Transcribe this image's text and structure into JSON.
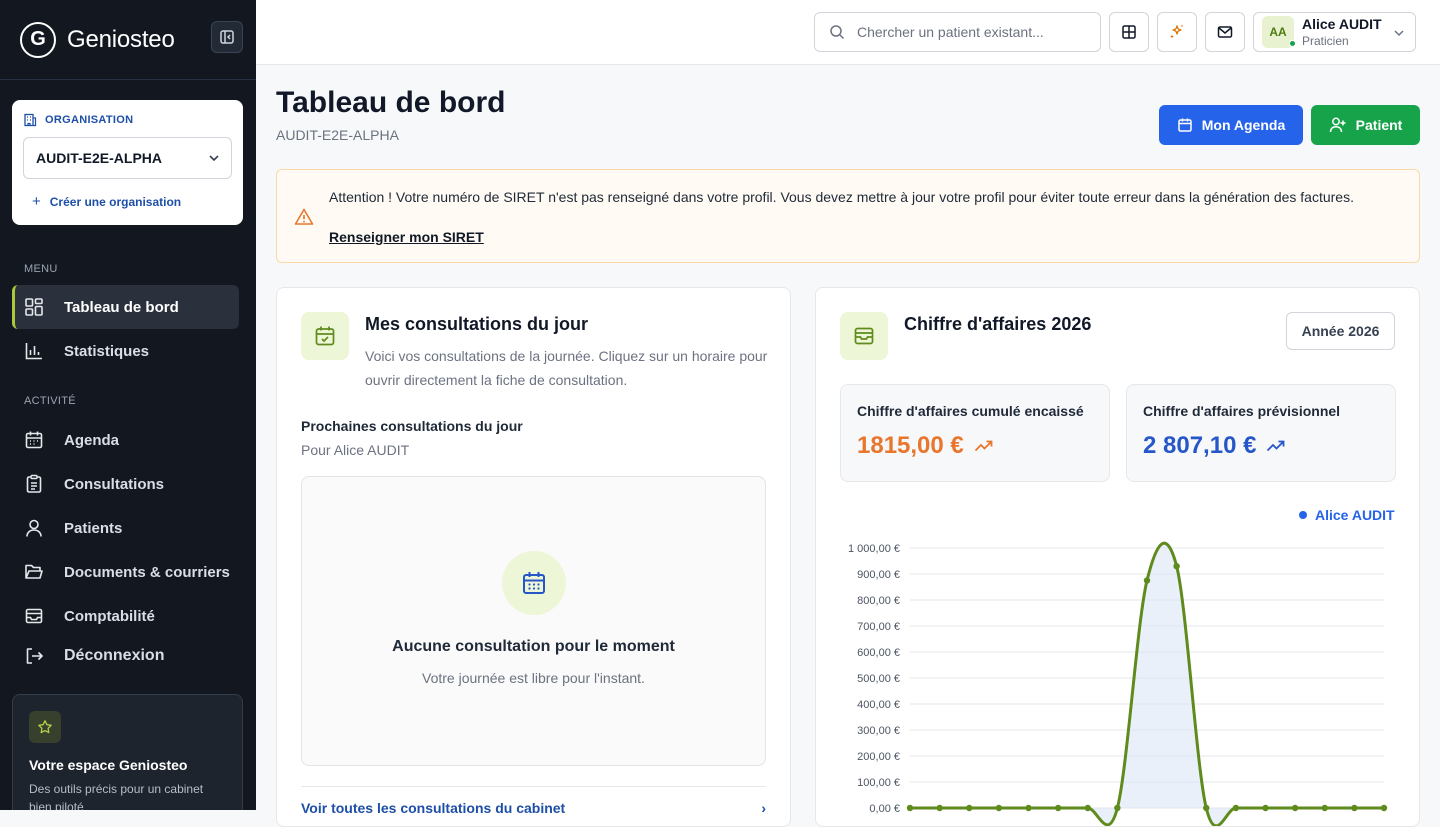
{
  "app": {
    "name": "Geniosteo",
    "logo_letter": "G"
  },
  "organization": {
    "label": "ORGANISATION",
    "selected": "AUDIT-E2E-ALPHA",
    "create_label": "Créer une organisation"
  },
  "menu": {
    "section_menu": "MENU",
    "section_activity": "ACTIVITÉ",
    "items": [
      {
        "label": "Tableau de bord",
        "icon": "dashboard-icon",
        "active": true
      },
      {
        "label": "Statistiques",
        "icon": "bar-chart-icon"
      },
      {
        "label": "Agenda",
        "icon": "calendar-icon"
      },
      {
        "label": "Consultations",
        "icon": "clipboard-icon"
      },
      {
        "label": "Patients",
        "icon": "user-icon"
      },
      {
        "label": "Documents & courriers",
        "icon": "folder-icon"
      },
      {
        "label": "Comptabilité",
        "icon": "inbox-icon"
      },
      {
        "label": "Déconnexion",
        "icon": "logout-icon"
      }
    ]
  },
  "promo": {
    "title": "Votre espace Geniosteo",
    "desc": "Des outils précis pour un cabinet bien piloté"
  },
  "topbar": {
    "search_placeholder": "Chercher un patient existant...",
    "user_initials": "AA",
    "user_name": "Alice AUDIT",
    "user_role": "Praticien"
  },
  "header": {
    "title": "Tableau de bord",
    "subtitle": "AUDIT-E2E-ALPHA",
    "agenda_btn": "Mon Agenda",
    "patient_btn": "Patient"
  },
  "alert": {
    "text": "Attention ! Votre numéro de SIRET n'est pas renseigné dans votre profil. Vous devez mettre à jour votre profil pour éviter toute erreur dans la génération des factures.",
    "link": "Renseigner mon SIRET"
  },
  "consultations": {
    "title": "Mes consultations du jour",
    "desc": "Voici vos consultations de la journée. Cliquez sur un horaire pour ouvrir directement la fiche de consultation.",
    "next_title": "Prochaines consultations du jour",
    "next_for": "Pour Alice AUDIT",
    "empty_title": "Aucune consultation pour le moment",
    "empty_desc": "Votre journée est libre pour l'instant.",
    "see_all": "Voir toutes les consultations du cabinet"
  },
  "revenue": {
    "title": "Chiffre d'affaires 2026",
    "year_btn": "Année 2026",
    "cumul_label": "Chiffre d'affaires cumulé encaissé",
    "cumul_value": "1815,00 €",
    "forecast_label": "Chiffre d'affaires prévisionnel",
    "forecast_value": "2 807,10 €",
    "legend": "Alice AUDIT"
  },
  "colors": {
    "accent": "#a8c93a",
    "line": "#5f8a1c",
    "orange": "#e8762d",
    "blue": "#2557c9",
    "green_btn": "#16a34a",
    "blue_btn": "#2563eb"
  },
  "chart_data": {
    "type": "line",
    "series": [
      {
        "name": "Alice AUDIT",
        "values": [
          0,
          0,
          0,
          0,
          0,
          0,
          0,
          0,
          875,
          930,
          0,
          0,
          0,
          0,
          0,
          0,
          0
        ]
      }
    ],
    "ylim": [
      0,
      1000
    ],
    "yticks": [
      "0,00 €",
      "100,00 €",
      "200,00 €",
      "300,00 €",
      "400,00 €",
      "500,00 €",
      "600,00 €",
      "700,00 €",
      "800,00 €",
      "900,00 €",
      "1 000,00 €"
    ],
    "grid": true
  }
}
